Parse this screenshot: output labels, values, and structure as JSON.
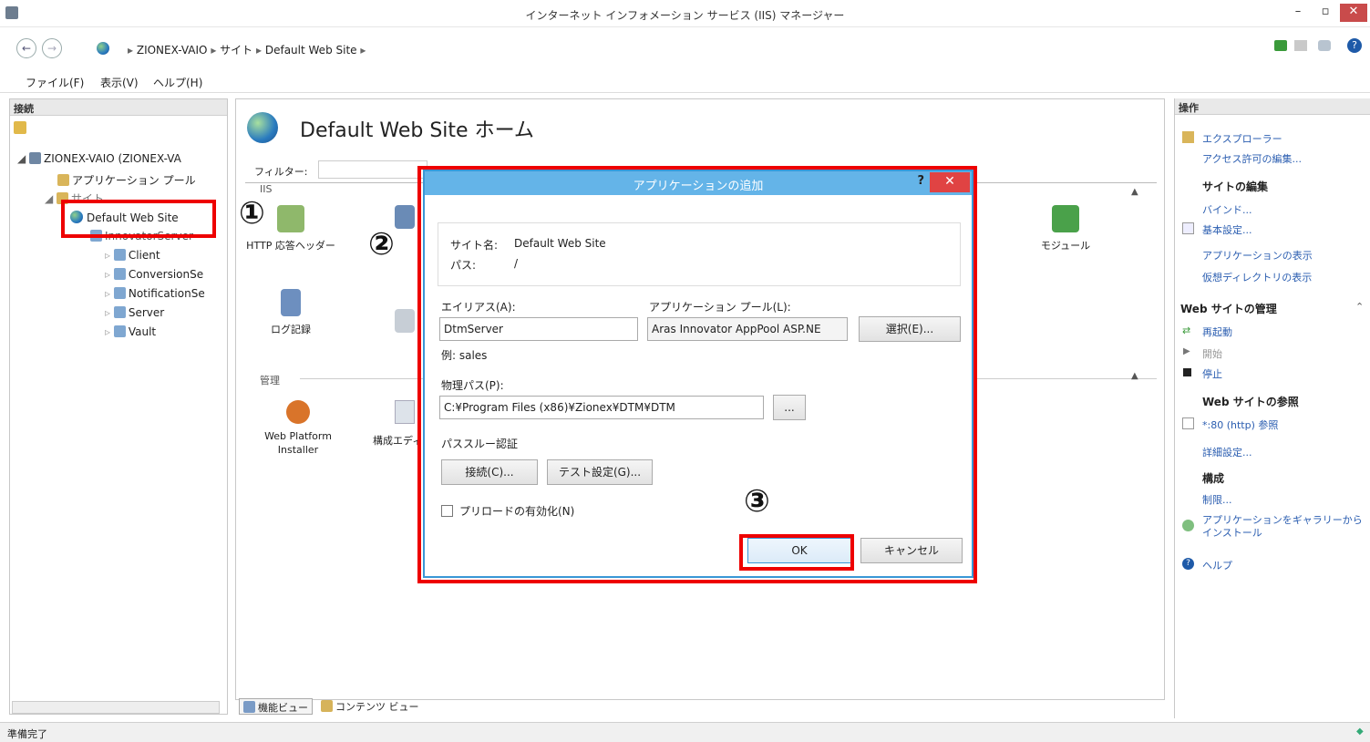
{
  "window": {
    "title": "インターネット インフォメーション サービス (IIS) マネージャー"
  },
  "breadcrumb": {
    "host": "ZIONEX-VAIO",
    "sites": "サイト",
    "site": "Default Web Site"
  },
  "menu": {
    "file": "ファイル(F)",
    "view": "表示(V)",
    "help": "ヘルプ(H)"
  },
  "left_panel": {
    "title": "接続",
    "root": "ZIONEX-VAIO (ZIONEX-VA",
    "app_pool": "アプリケーション プール",
    "sites": "サイト",
    "default_site": "Default Web Site",
    "innovator": "InnovatorServer",
    "children": [
      "Client",
      "ConversionSe",
      "NotificationSe",
      "Server",
      "Vault"
    ]
  },
  "center": {
    "title": "Default Web Site ホーム",
    "filter_label": "フィルター:",
    "section_iis": "IIS",
    "section_manage": "管理",
    "features": [
      "HTTP 応答ヘッダー",
      "モジュール",
      "ログ記録",
      "Web Platform Installer",
      "構成エディター"
    ],
    "tabs": {
      "features": "機能ビュー",
      "content": "コンテンツ ビュー"
    }
  },
  "right_panel": {
    "title": "操作",
    "explore": "エクスプローラー",
    "edit_perm": "アクセス許可の編集...",
    "edit_site": "サイトの編集",
    "bindings": "バインド...",
    "basic": "基本設定...",
    "show_apps": "アプリケーションの表示",
    "show_vdirs": "仮想ディレクトリの表示",
    "manage_site": "Web サイトの管理",
    "restart": "再起動",
    "start": "開始",
    "stop": "停止",
    "browse_site": "Web サイトの参照",
    "browse_link": "*:80 (http) 参照",
    "advanced": "詳細設定...",
    "config": "構成",
    "limits": "制限...",
    "install_gallery": "アプリケーションをギャラリーからインストール",
    "help": "ヘルプ"
  },
  "dialog": {
    "title": "アプリケーションの追加",
    "help": "?",
    "site_label": "サイト名:",
    "site_value": "Default Web Site",
    "path_label": "パス:",
    "path_value": "/",
    "alias_label": "エイリアス(A):",
    "alias_value": "DtmServer",
    "alias_example": "例: sales",
    "pool_label": "アプリケーション プール(L):",
    "pool_value": "Aras Innovator AppPool ASP.NE",
    "select_button": "選択(E)...",
    "phys_label": "物理パス(P):",
    "phys_value": "C:¥Program Files (x86)¥Zionex¥DTM¥DTM",
    "browse_button": "...",
    "passthrough_label": "パススルー認証",
    "connect_button": "接続(C)...",
    "test_button": "テスト設定(G)...",
    "preload_label": "プリロードの有効化(N)",
    "ok": "OK",
    "cancel": "キャンセル"
  },
  "annotations": {
    "one": "①",
    "two": "②",
    "three": "③"
  },
  "status": {
    "text": "準備完了"
  }
}
